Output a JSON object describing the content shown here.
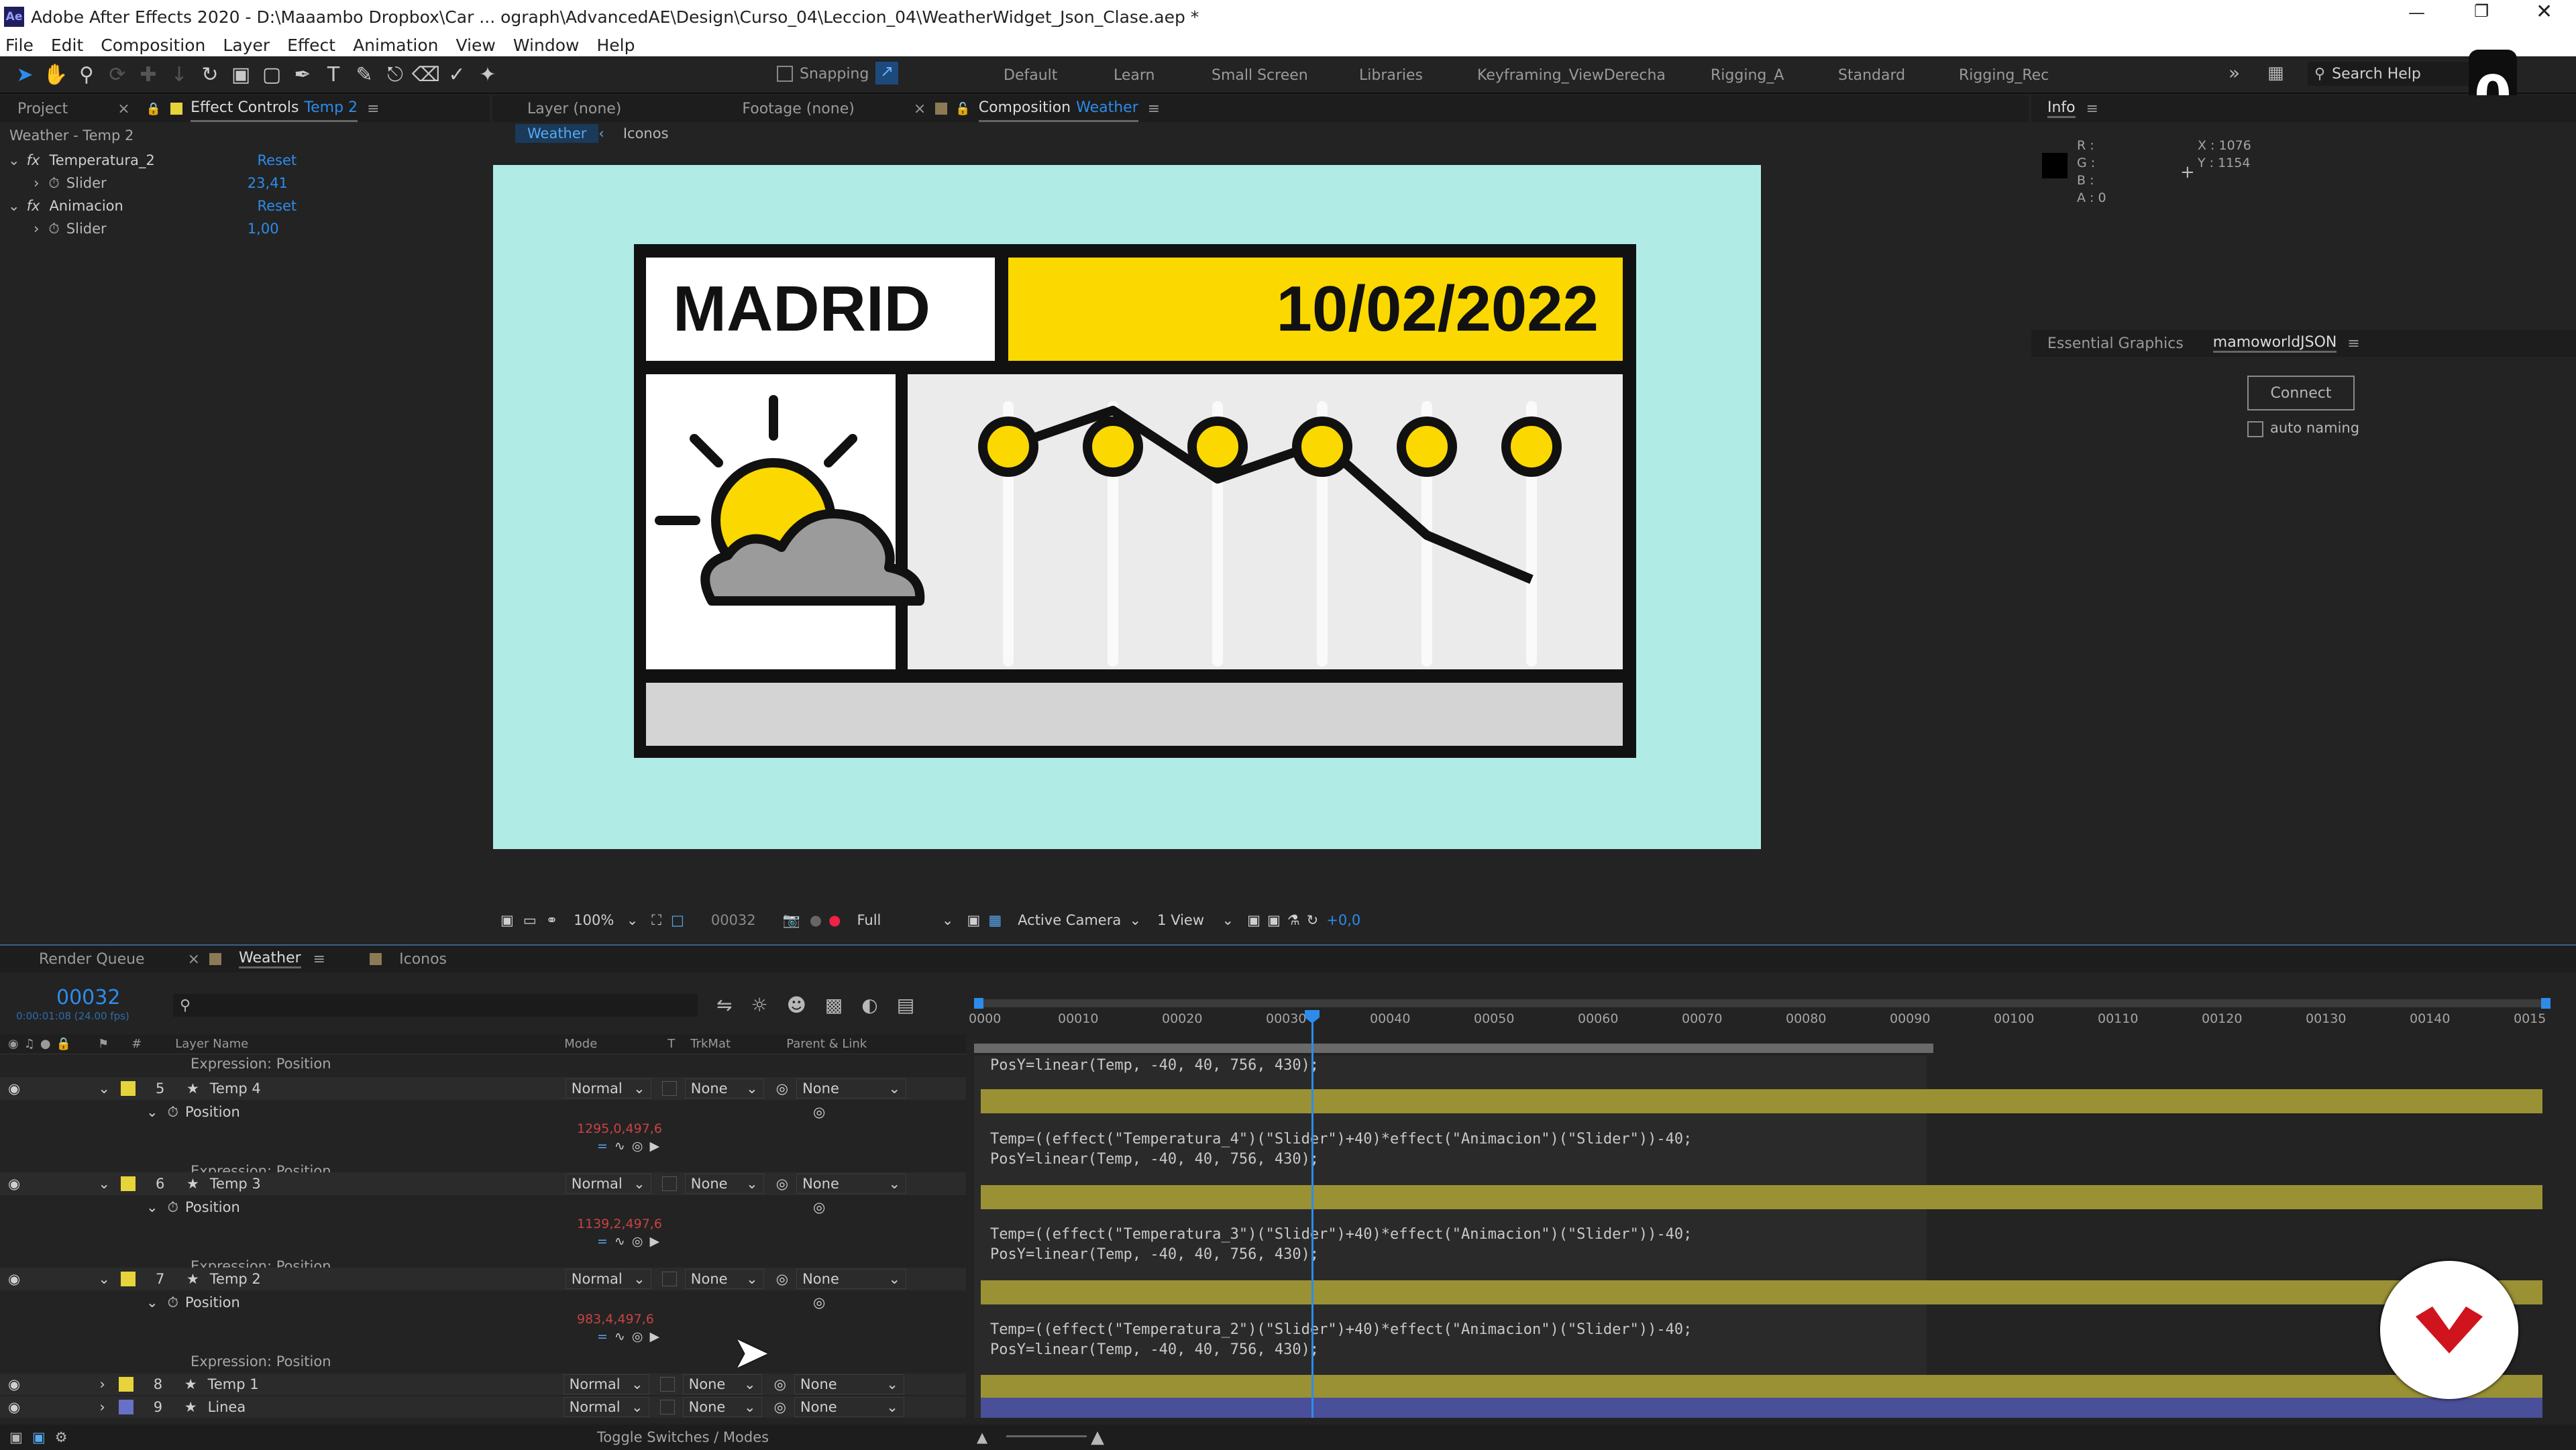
{
  "app": {
    "title": "Adobe After Effects 2020 - D:\\Maaambo Dropbox\\Car ... ograph\\AdvancedAE\\Design\\Curso_04\\Leccion_04\\WeatherWidget_Json_Clase.aep *"
  },
  "menu": [
    "File",
    "Edit",
    "Composition",
    "Layer",
    "Effect",
    "Animation",
    "View",
    "Window",
    "Help"
  ],
  "toolbar": {
    "snapping": "Snapping",
    "search": "Search Help"
  },
  "workspaces": [
    "Default",
    "Learn",
    "Small Screen",
    "Libraries",
    "Keyframing_ViewDerecha",
    "Rigging_A",
    "Standard",
    "Rigging_Rec"
  ],
  "badge": "0",
  "left_panel": {
    "tabs": [
      "Project",
      "Effect Controls"
    ],
    "effect_controls_target": "Temp 2",
    "header": "Weather - Temp 2",
    "effects": [
      {
        "name": "Temperatura_2",
        "reset": "Reset",
        "prop": "Slider",
        "value": "23,41"
      },
      {
        "name": "Animacion",
        "reset": "Reset",
        "prop": "Slider",
        "value": "1,00"
      }
    ]
  },
  "viewer": {
    "tabs": [
      "Layer  (none)",
      "Footage  (none)",
      "Composition"
    ],
    "comp_name": "Weather",
    "subtabs": [
      "Weather",
      "Iconos"
    ],
    "zoom": "100%",
    "timecode": "00032",
    "resolution": "Full",
    "camera": "Active Camera",
    "view": "1 View",
    "exposure": "+0,0"
  },
  "widget": {
    "city": "MADRID",
    "date": "10/02/2022",
    "colors": {
      "bg": "#b0ebe6",
      "yellow": "#fbd800",
      "panel": "#ebebeb",
      "cloud": "#9b9b9b",
      "footer": "#d4d4d4",
      "ink": "#111111"
    },
    "chart_points": [
      3.5,
      4.4,
      2.7,
      3.6,
      1.3,
      0.2
    ]
  },
  "info": {
    "title": "Info",
    "r": "R :",
    "g": "G :",
    "b": "B :",
    "a": "A : 0",
    "x": "X : 1076",
    "y": "Y : 1154"
  },
  "essential": {
    "tabs": [
      "Essential Graphics",
      "mamoworldJSON"
    ],
    "connect": "Connect",
    "auto_naming": "auto naming"
  },
  "timeline": {
    "tabs": [
      "Render Queue",
      "Weather",
      "Iconos"
    ],
    "timecode": "00032",
    "fps": "0:00:01:08 (24.00 fps)",
    "columns": {
      "layer_name": "Layer Name",
      "mode": "Mode",
      "t": "T",
      "trkmat": "TrkMat",
      "parent": "Parent & Link"
    },
    "ruler": [
      "0000",
      "00010",
      "00020",
      "00030",
      "00040",
      "00050",
      "00060",
      "00070",
      "00080",
      "00090",
      "00100",
      "00110",
      "00120",
      "00130",
      "00140",
      "0015"
    ],
    "expr_top": "Expression: Position",
    "layers": [
      {
        "num": "5",
        "name": "Temp 4",
        "mode": "Normal",
        "trk": "None",
        "parent": "None",
        "prop": "Position",
        "value": "1295,0,497,6",
        "expr": "Expression: Position",
        "code": [
          "PosY=linear(Temp, -40, 40, 756, 430);"
        ]
      },
      {
        "num": "6",
        "name": "Temp 3",
        "mode": "Normal",
        "trk": "None",
        "parent": "None",
        "prop": "Position",
        "value": "1139,2,497,6",
        "expr": "Expression: Position",
        "code": [
          "Temp=((effect(\"Temperatura_4\")(\"Slider\")+40)*effect(\"Animacion\")(\"Slider\"))-40;",
          "PosY=linear(Temp, -40, 40, 756, 430);"
        ]
      },
      {
        "num": "7",
        "name": "Temp 2",
        "mode": "Normal",
        "trk": "None",
        "parent": "None",
        "prop": "Position",
        "value": "983,4,497,6",
        "expr": "Expression: Position",
        "code": [
          "Temp=((effect(\"Temperatura_3\")(\"Slider\")+40)*effect(\"Animacion\")(\"Slider\"))-40;",
          "PosY=linear(Temp, -40, 40, 756, 430);"
        ]
      },
      {
        "num": "8",
        "name": "Temp 1",
        "mode": "Normal",
        "trk": "None",
        "parent": "None",
        "code": [
          "Temp=((effect(\"Temperatura_2\")(\"Slider\")+40)*effect(\"Animacion\")(\"Slider\"))-40;",
          "PosY=linear(Temp, -40, 40, 756, 430);"
        ]
      },
      {
        "num": "9",
        "name": "Linea",
        "mode": "Normal",
        "trk": "None",
        "parent": "None"
      }
    ],
    "footer": "Toggle Switches / Modes"
  }
}
